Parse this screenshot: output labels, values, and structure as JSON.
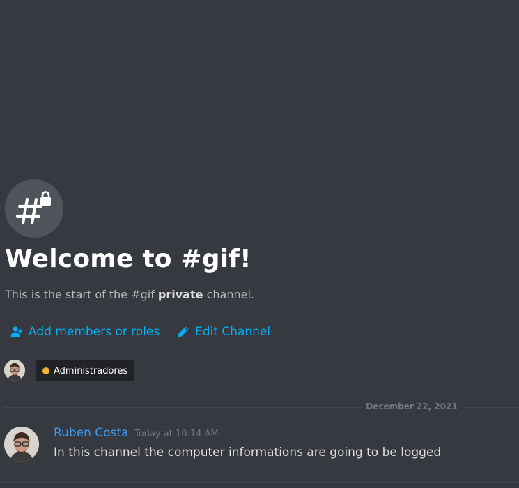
{
  "channel": {
    "name": "gif",
    "icon": "hash-lock-icon"
  },
  "welcome": {
    "title": "Welcome to #gif!",
    "subtitle_prefix": "This is the start of the #gif ",
    "subtitle_bold": "private",
    "subtitle_suffix": " channel."
  },
  "actions": {
    "add_members_label": "Add members or roles",
    "add_members_icon": "add-member-icon",
    "edit_channel_label": "Edit Channel",
    "edit_channel_icon": "pencil-icon"
  },
  "members": {
    "role_label": "Administradores",
    "role_color": "#f0b232"
  },
  "divider": {
    "date": "December 22, 2021"
  },
  "message": {
    "author": "Ruben Costa",
    "author_color": "#3a9cf1",
    "timestamp": "Today at 10:14 AM",
    "text": "In this channel the computer informations are going to be logged"
  },
  "colors": {
    "background": "#36393f",
    "link": "#00aff4",
    "icon_circle": "#4f545c"
  }
}
